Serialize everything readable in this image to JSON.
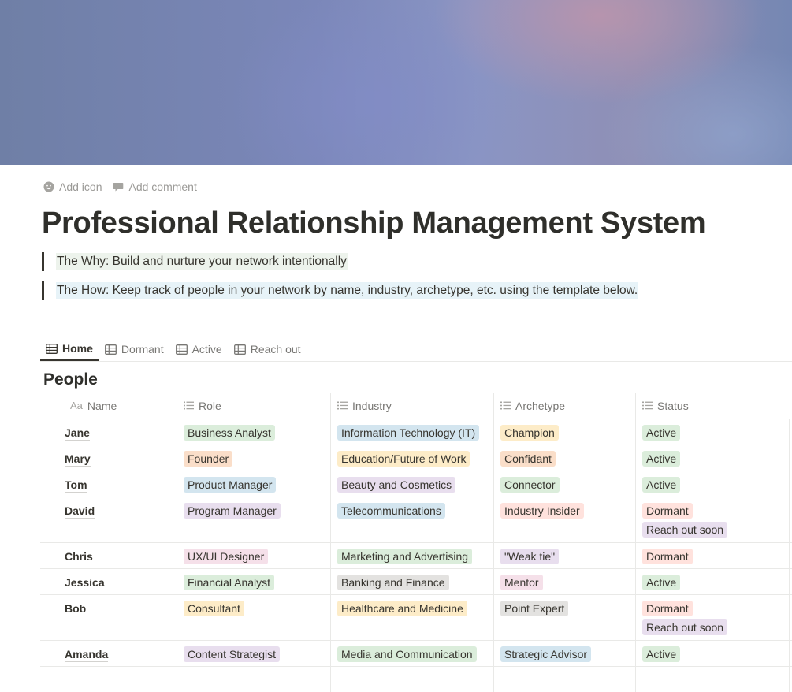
{
  "page": {
    "add_icon_label": "Add icon",
    "add_comment_label": "Add comment",
    "title": "Professional Relationship Management System",
    "quotes": [
      "The Why: Build and nurture your network intentionally",
      "The How: Keep track of people in your network by name, industry, archetype, etc. using the template below."
    ]
  },
  "views": {
    "tabs": [
      {
        "label": "Home",
        "icon": "table-icon",
        "active": true
      },
      {
        "label": "Dormant",
        "icon": "table-icon",
        "active": false
      },
      {
        "label": "Active",
        "icon": "table-icon",
        "active": false
      },
      {
        "label": "Reach out",
        "icon": "table-icon",
        "active": false
      }
    ]
  },
  "database": {
    "title": "People",
    "columns": [
      {
        "label": "Name",
        "icon": "Aa"
      },
      {
        "label": "Role",
        "icon": "list-icon"
      },
      {
        "label": "Industry",
        "icon": "list-icon"
      },
      {
        "label": "Archetype",
        "icon": "list-icon"
      },
      {
        "label": "Status",
        "icon": "list-icon"
      }
    ],
    "rows": [
      {
        "name": "Jane",
        "role": "Business Analyst",
        "industry": "Information Technology (IT)",
        "archetype": "Champion",
        "status": [
          "Active"
        ]
      },
      {
        "name": "Mary",
        "role": "Founder",
        "industry": "Education/Future of Work",
        "archetype": "Confidant",
        "status": [
          "Active"
        ]
      },
      {
        "name": "Tom",
        "role": "Product Manager",
        "industry": "Beauty and Cosmetics",
        "archetype": "Connector",
        "status": [
          "Active"
        ]
      },
      {
        "name": "David",
        "role": "Program Manager",
        "industry": "Telecommunications",
        "archetype": "Industry Insider",
        "status": [
          "Dormant",
          "Reach out soon"
        ]
      },
      {
        "name": "Chris",
        "role": "UX/UI Designer",
        "industry": "Marketing and Advertising",
        "archetype": "\"Weak tie\"",
        "status": [
          "Dormant"
        ]
      },
      {
        "name": "Jessica",
        "role": "Financial Analyst",
        "industry": "Banking and Finance",
        "archetype": "Mentor",
        "status": [
          "Active"
        ]
      },
      {
        "name": "Bob",
        "role": "Consultant",
        "industry": "Healthcare and Medicine",
        "archetype": "Point Expert",
        "status": [
          "Dormant",
          "Reach out soon"
        ]
      },
      {
        "name": "Amanda",
        "role": "Content Strategist",
        "industry": "Media and Communication",
        "archetype": "Strategic Advisor",
        "status": [
          "Active"
        ]
      }
    ]
  },
  "tag_colors": {
    "green": "#dbeddb",
    "orange": "#fadec9",
    "yellow": "#fdecc8",
    "blue": "#d3e5ef",
    "purple": "#e8deee",
    "pink": "#f5e0e9",
    "red": "#ffe2dd",
    "gray": "#e3e2e0"
  }
}
